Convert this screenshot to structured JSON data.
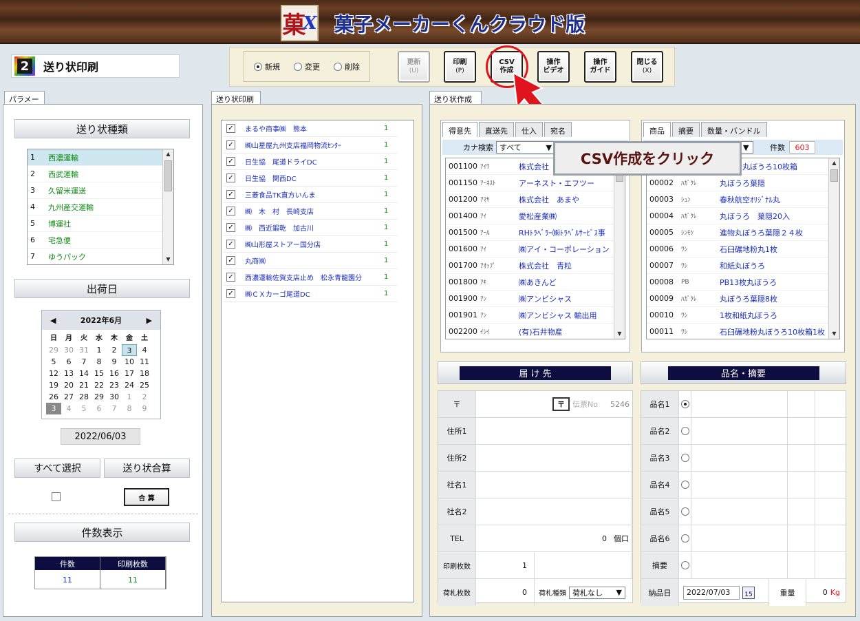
{
  "app": {
    "title": "菓子メーカーくんクラウド版",
    "logo_text": "菓",
    "logo_sub": "X"
  },
  "screen": {
    "number": "2",
    "title": "送り状印刷"
  },
  "toolbar": {
    "modes": [
      {
        "label": "新規",
        "checked": true
      },
      {
        "label": "変更",
        "checked": false
      },
      {
        "label": "削除",
        "checked": false
      }
    ],
    "buttons": [
      {
        "label": "更新",
        "key": "(U)",
        "enabled": false
      },
      {
        "label": "印刷",
        "key": "(P)",
        "enabled": true
      },
      {
        "label": "CSV",
        "key": "作成",
        "enabled": true
      },
      {
        "label": "操作",
        "key": "ビデオ",
        "enabled": true
      },
      {
        "label": "操作",
        "key": "ガイド",
        "enabled": true
      },
      {
        "label": "閉じる",
        "key": "(X)",
        "enabled": true
      }
    ]
  },
  "callout": {
    "text": "CSV作成をクリック",
    "accent": "#e0141c"
  },
  "left": {
    "tab": "パラメータ",
    "type_header": "送り状種類",
    "types": [
      {
        "n": "1",
        "name": "西濃運輸"
      },
      {
        "n": "2",
        "name": "西武運輸"
      },
      {
        "n": "3",
        "name": "久留米運送"
      },
      {
        "n": "4",
        "name": "九州産交運輸"
      },
      {
        "n": "5",
        "name": "博運社"
      },
      {
        "n": "6",
        "name": "宅急便"
      },
      {
        "n": "7",
        "name": "ゆうパック"
      }
    ],
    "date_header": "出荷日",
    "calendar": {
      "month": "2022年6月",
      "dow": [
        "日",
        "月",
        "火",
        "水",
        "木",
        "金",
        "土"
      ],
      "weeks": [
        [
          "29",
          "30",
          "31",
          "1",
          "2",
          "3",
          "4"
        ],
        [
          "5",
          "6",
          "7",
          "8",
          "9",
          "10",
          "11"
        ],
        [
          "12",
          "13",
          "14",
          "15",
          "16",
          "17",
          "18"
        ],
        [
          "19",
          "20",
          "21",
          "22",
          "23",
          "24",
          "25"
        ],
        [
          "26",
          "27",
          "28",
          "29",
          "30",
          "1",
          "2"
        ],
        [
          "3",
          "4",
          "5",
          "6",
          "7",
          "8",
          "9"
        ]
      ]
    },
    "ship_date": "2022/06/03",
    "select_all": "すべて選択",
    "sum_btn": "送り状合算",
    "goukei": "合 算",
    "count_header": "件数表示",
    "count_cols": [
      "件数",
      "印刷枚数"
    ],
    "count_vals": [
      "11",
      "11"
    ]
  },
  "middle": {
    "tab": "送り状印刷",
    "items": [
      {
        "name": "まるや商事㈱　熊本",
        "count": "1"
      },
      {
        "name": "㈱山星屋九州支店福岡物流ｾﾝﾀｰ",
        "count": "1"
      },
      {
        "name": "日生協　尾道ドライDC",
        "count": "1"
      },
      {
        "name": "日生協　関西DC",
        "count": "1"
      },
      {
        "name": "三菱食品TK直方いんま",
        "count": "1"
      },
      {
        "name": "㈱　木　村　長崎支店",
        "count": "1"
      },
      {
        "name": "㈱　西近鍛乾　加古川",
        "count": "1"
      },
      {
        "name": "㈱山形屋ストアー国分店",
        "count": "1"
      },
      {
        "name": "丸商㈱",
        "count": "1"
      },
      {
        "name": "西濃運輸佐賀支店止め　松永青龍園分",
        "count": "1"
      },
      {
        "name": "㈱ＣＸカーゴ尾道DC",
        "count": "1"
      }
    ]
  },
  "right": {
    "tab": "送り状作成",
    "cust_tabs": [
      "得意先",
      "直送先",
      "仕入",
      "宛名"
    ],
    "kana_label": "カナ検索",
    "kana_value": "すべて",
    "customers": [
      {
        "code": "001100",
        "kana": "ｱｲﾜ",
        "name": "株式会社"
      },
      {
        "code": "001150",
        "kana": "ｱｰﾈｽﾄ",
        "name": "アーネスト・エフツー"
      },
      {
        "code": "001200",
        "kana": "ｱﾏﾔ",
        "name": "株式会社　あまや"
      },
      {
        "code": "001400",
        "kana": "ｱｲ",
        "name": "愛松産業㈱"
      },
      {
        "code": "001500",
        "kana": "ｱｰﾙ",
        "name": "RHﾄﾗﾍﾞﾗｰ㈱ﾄﾗﾍﾞﾙｻｰﾋﾞｽ事"
      },
      {
        "code": "001600",
        "kana": "ｱｲ",
        "name": "㈱アイ・コーポレーション"
      },
      {
        "code": "001700",
        "kana": "ｱｵｯﾌﾟ",
        "name": "株式会社　青粒"
      },
      {
        "code": "001800",
        "kana": "ｱｷ",
        "name": "㈱あきんど"
      },
      {
        "code": "001900",
        "kana": "ｱﾝ",
        "name": "㈱アンビシャス"
      },
      {
        "code": "001901",
        "kana": "ｱﾝ",
        "name": "㈱アンビシャス 輸出用"
      },
      {
        "code": "002200",
        "kana": "ｲｼｲ",
        "name": "(有)石井物産"
      }
    ],
    "prod_tabs": [
      "商品",
      "摘要",
      "数量・バンドル"
    ],
    "count_label": "件数",
    "count_value": "603",
    "products": [
      {
        "code": "00001",
        "kana": "",
        "name": "碾地粉丸ぼうろ10枚箱"
      },
      {
        "code": "00002",
        "kana": "ﾊｶﾞｸﾚ",
        "name": "丸ぼうろ葉隠"
      },
      {
        "code": "00003",
        "kana": "ｼｭﾝ",
        "name": "春秋航空ｵﾘｼﾞﾅﾙ丸"
      },
      {
        "code": "00004",
        "kana": "ﾊｶﾞｸﾚ",
        "name": "丸ぼうろ　葉隠20入"
      },
      {
        "code": "00005",
        "kana": "ｼﾝﾓﾂ",
        "name": "進物丸ぼうろ葉隠２４枚"
      },
      {
        "code": "00006",
        "kana": "ﾜｼ",
        "name": "石臼碾地粉丸1枚"
      },
      {
        "code": "00007",
        "kana": "ﾜｼ",
        "name": "和紙丸ぼうろ"
      },
      {
        "code": "00008",
        "kana": "PB",
        "name": "PB13枚丸ぼうろ"
      },
      {
        "code": "00009",
        "kana": "ﾊｶﾞｸﾚ",
        "name": "丸ぼうろ葉隠8枚"
      },
      {
        "code": "00010",
        "kana": "ﾜｼ",
        "name": "1枚和紙丸ぼうろ"
      },
      {
        "code": "00011",
        "kana": "ﾜｼ",
        "name": "石臼碾地粉丸ぼうろ10枚箱1枚"
      }
    ],
    "dest_header": "届 け 先",
    "dest": {
      "zip": "〒",
      "denpyo": "伝票No",
      "denpyo_val": "5246",
      "addr1": "住所1",
      "addr2": "住所2",
      "co1": "社名1",
      "co2": "社名2",
      "tel": "TEL",
      "tel_val": "0",
      "kuchi": "個口",
      "print_cnt": "印刷枚数",
      "print_val": "1",
      "tag_cnt": "荷札枚数",
      "tag_val": "0",
      "tag_type": "荷札種類",
      "tag_type_val": "荷札なし"
    },
    "item_header": "品名・摘要",
    "items": [
      "品名1",
      "品名2",
      "品名3",
      "品名4",
      "品名5",
      "品名6",
      "摘要"
    ],
    "deliv_label": "納品日",
    "deliv_date": "2022/07/03",
    "cal_icon": "15",
    "weight_label": "重量",
    "weight_val": "0",
    "weight_unit": "Kg"
  }
}
